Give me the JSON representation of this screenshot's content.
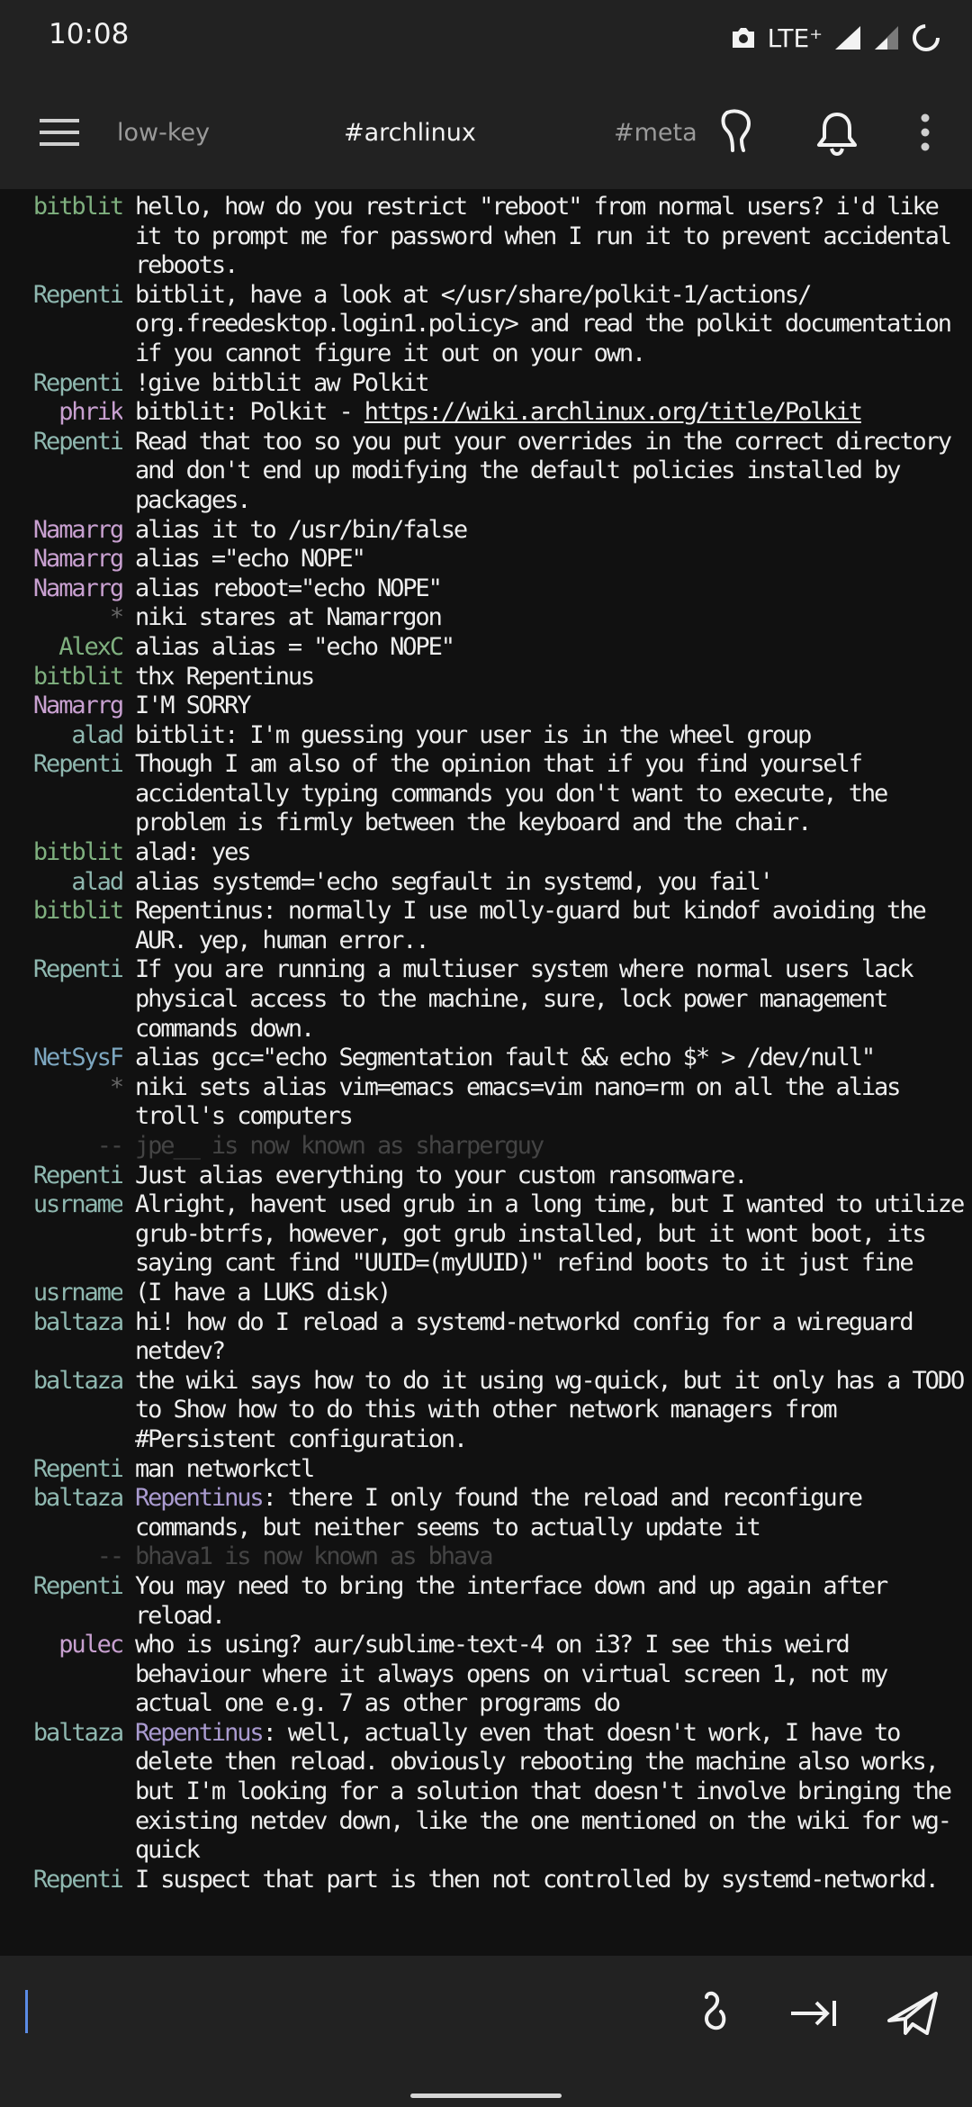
{
  "status": {
    "time": "10:08",
    "network": "LTE⁺"
  },
  "toolbar": {
    "tabs": [
      {
        "label": "low-key"
      },
      {
        "label": "#archlinux"
      },
      {
        "label": "#meta"
      }
    ]
  },
  "colors": {
    "nick_green": "#7fb07f",
    "nick_teal": "#8fb8b0",
    "nick_pink": "#c8a0d0",
    "nick_purple": "#a99ad4",
    "nick_blue": "#7da7c0",
    "nick_mention": "#aa9bd0",
    "cursor": "#5b8ce6",
    "bar_bg": "#222222",
    "chat_bg": "#111111"
  },
  "chat": {
    "messages": [
      {
        "nick": "bitblit",
        "color": "#7fb07f",
        "text": "hello, how do you restrict \"reboot\" from normal users? i'd like it to prompt me for password when I run it to prevent accidental reboots."
      },
      {
        "nick": "Repenti",
        "color": "#8fb8b0",
        "text": "bitblit, have a look at </usr/share/polkit-1/actions/ org.freedesktop.login1.policy> and read the polkit documentation if you cannot figure it out on your own."
      },
      {
        "nick": "Repenti",
        "color": "#8fb8b0",
        "text": "!give bitblit aw Polkit"
      },
      {
        "nick": "phrik",
        "color": "#c8a0d0",
        "pre": "bitblit: Polkit - ",
        "link": "https://wiki.archlinux.org/title/Polkit"
      },
      {
        "nick": "Repenti",
        "color": "#8fb8b0",
        "text": "Read that too so you put your overrides in the correct directory and don't end up modifying the default policies installed by packages."
      },
      {
        "nick": "Namarrg",
        "color": "#c8a0d0",
        "text": "alias it to /usr/bin/false"
      },
      {
        "nick": "Namarrg",
        "color": "#c8a0d0",
        "text": "alias =\"echo NOPE\""
      },
      {
        "nick": "Namarrg",
        "color": "#c8a0d0",
        "text": "alias reboot=\"echo NOPE\""
      },
      {
        "nick": "*",
        "kind": "action",
        "text": "niki stares at Namarrgon"
      },
      {
        "nick": "AlexC",
        "color": "#7fb07f",
        "text": "alias alias = \"echo NOPE\""
      },
      {
        "nick": "bitblit",
        "color": "#7fb07f",
        "text": "thx Repentinus"
      },
      {
        "nick": "Namarrg",
        "color": "#c8a0d0",
        "text": "I'M SORRY"
      },
      {
        "nick": "alad",
        "color": "#8fb8b0",
        "text": "bitblit: I'm guessing your user is in the wheel group"
      },
      {
        "nick": "Repenti",
        "color": "#8fb8b0",
        "text": "Though I am also of the opinion that if you find yourself accidentally typing commands you don't want to execute, the problem is firmly between the keyboard and the chair."
      },
      {
        "nick": "bitblit",
        "color": "#7fb07f",
        "text": "alad: yes"
      },
      {
        "nick": "alad",
        "color": "#8fb8b0",
        "text": "alias systemd='echo segfault in systemd, you fail'"
      },
      {
        "nick": "bitblit",
        "color": "#7fb07f",
        "text": "Repentinus: normally I use molly-guard but kindof avoiding the AUR. yep, human error.."
      },
      {
        "nick": "Repenti",
        "color": "#8fb8b0",
        "text": "If you are running a multiuser system where normal users lack physical access to the machine, sure, lock power management commands down."
      },
      {
        "nick": "NetSysF",
        "color": "#7da7c0",
        "text": "alias gcc=\"echo Segmentation fault && echo $* > /dev/null\""
      },
      {
        "nick": "*",
        "kind": "action",
        "text": "niki sets alias vim=emacs emacs=vim nano=rm on all the alias troll's computers"
      },
      {
        "nick": "--",
        "kind": "sys",
        "text": "jpe__ is now known as sharperguy"
      },
      {
        "nick": "Repenti",
        "color": "#8fb8b0",
        "text": "Just alias everything to your custom ransomware."
      },
      {
        "nick": "usrname",
        "color": "#8fb8b0",
        "text": "Alright, havent used grub in a long time, but I wanted to utilize grub-btrfs, however, got grub installed, but it wont boot, its saying cant find \"UUID=(myUUID)\" refind boots to it just fine"
      },
      {
        "nick": "usrname",
        "color": "#8fb8b0",
        "text": "(I have a LUKS disk)"
      },
      {
        "nick": "baltaza",
        "color": "#8fb8b0",
        "text": "hi! how do I reload a systemd-networkd config for a wireguard netdev?"
      },
      {
        "nick": "baltaza",
        "color": "#8fb8b0",
        "text": "the wiki says how to do it using wg-quick, but it only has a TODO to Show how to do this with other network managers from #Persistent configuration."
      },
      {
        "nick": "Repenti",
        "color": "#8fb8b0",
        "text": "man networkctl"
      },
      {
        "nick": "baltaza",
        "color": "#8fb8b0",
        "mention": "Repentinus",
        "text": ": there I only found the reload and reconfigure commands, but neither seems to actually update it"
      },
      {
        "nick": "--",
        "kind": "sys",
        "text": "bhava1 is now known as bhava"
      },
      {
        "nick": "Repenti",
        "color": "#8fb8b0",
        "text": "You may need to bring the interface down and up again after reload."
      },
      {
        "nick": "pulec",
        "color": "#c8a0d0",
        "text": "who is using? aur/sublime-text-4 on i3? I see this weird behaviour where it always opens on virtual screen 1, not my actual one e.g. 7 as other programs do"
      },
      {
        "nick": "baltaza",
        "color": "#8fb8b0",
        "mention": "Repentinus",
        "text": ": well, actually even that doesn't work, I have to delete then reload. obviously rebooting the machine also works, but I'm looking for a solution that doesn't involve bringing the existing netdev down, like the one mentioned on the wiki for wg-quick"
      },
      {
        "nick": "Repenti",
        "color": "#8fb8b0",
        "text": "I suspect that part is then not controlled by systemd-networkd."
      }
    ]
  },
  "input": {
    "placeholder": ""
  },
  "icons": {
    "menu": "menu-icon",
    "channel_info": "channel-info-icon",
    "notifications": "bell-icon",
    "overflow": "more-vert-icon",
    "attach": "attach-icon",
    "tab_complete": "tab-complete-icon",
    "send": "send-icon"
  }
}
